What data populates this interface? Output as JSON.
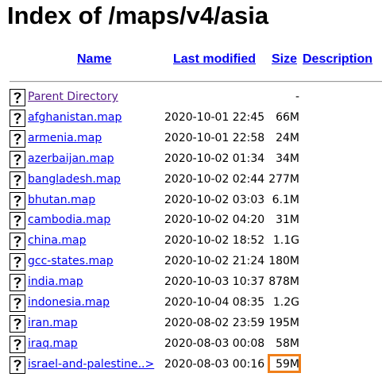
{
  "page": {
    "title": "Index of /maps/v4/asia"
  },
  "columns": {
    "name": "Name",
    "last_modified": "Last modified",
    "size": "Size",
    "description": "Description"
  },
  "rows": [
    {
      "name": "Parent Directory",
      "date": "",
      "size": "-",
      "icon": "unknown-file-icon"
    },
    {
      "name": "afghanistan.map",
      "date": "2020-10-01 22:45",
      "size": "66M",
      "icon": "unknown-file-icon"
    },
    {
      "name": "armenia.map",
      "date": "2020-10-01 22:58",
      "size": "24M",
      "icon": "unknown-file-icon"
    },
    {
      "name": "azerbaijan.map",
      "date": "2020-10-02 01:34",
      "size": "34M",
      "icon": "unknown-file-icon"
    },
    {
      "name": "bangladesh.map",
      "date": "2020-10-02 02:44",
      "size": "277M",
      "icon": "unknown-file-icon"
    },
    {
      "name": "bhutan.map",
      "date": "2020-10-02 03:03",
      "size": "6.1M",
      "icon": "unknown-file-icon"
    },
    {
      "name": "cambodia.map",
      "date": "2020-10-02 04:20",
      "size": "31M",
      "icon": "unknown-file-icon"
    },
    {
      "name": "china.map",
      "date": "2020-10-02 18:52",
      "size": "1.1G",
      "icon": "unknown-file-icon"
    },
    {
      "name": "gcc-states.map",
      "date": "2020-10-02 21:24",
      "size": "180M",
      "icon": "unknown-file-icon"
    },
    {
      "name": "india.map",
      "date": "2020-10-03 10:37",
      "size": "878M",
      "icon": "unknown-file-icon"
    },
    {
      "name": "indonesia.map",
      "date": "2020-10-04 08:35",
      "size": "1.2G",
      "icon": "unknown-file-icon"
    },
    {
      "name": "iran.map",
      "date": "2020-08-02 23:59",
      "size": "195M",
      "icon": "unknown-file-icon"
    },
    {
      "name": "iraq.map",
      "date": "2020-08-03 00:08",
      "size": "58M",
      "icon": "unknown-file-icon"
    },
    {
      "name": "israel-and-palestine..>",
      "date": "2020-08-03 00:16",
      "size": "59M",
      "icon": "unknown-file-icon"
    }
  ],
  "colors": {
    "link": "#0000ee",
    "visited_link": "#551a8b",
    "highlight_box": "#f07f1a"
  }
}
